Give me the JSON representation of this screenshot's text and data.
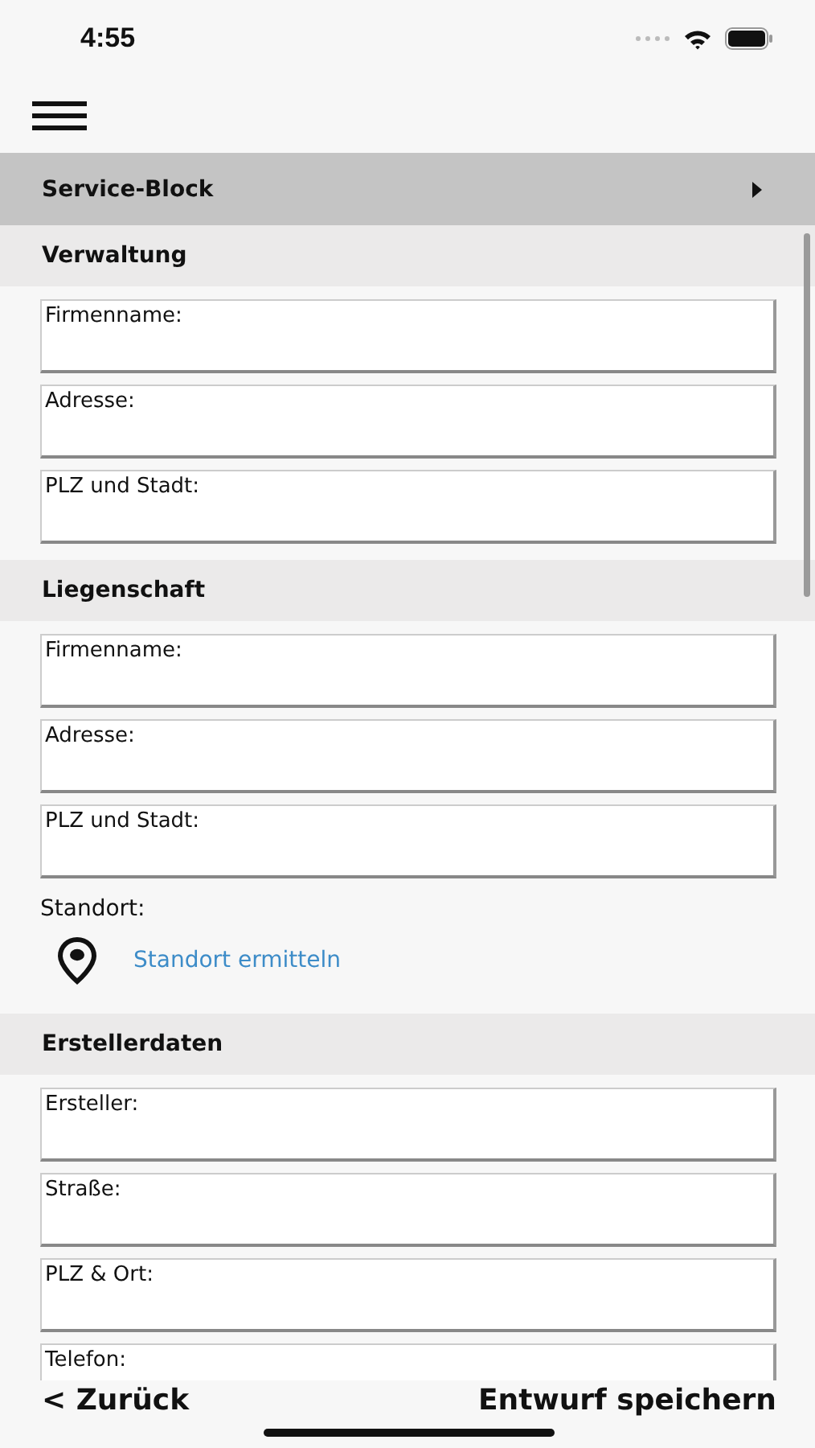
{
  "status_bar": {
    "time": "4:55"
  },
  "service_block": {
    "title": "Service-Block",
    "expanded": false
  },
  "sections": [
    {
      "title": "Verwaltung",
      "items": [
        {
          "kind": "field",
          "placeholder": "Firmenname:"
        },
        {
          "kind": "field",
          "placeholder": "Adresse:"
        },
        {
          "kind": "field",
          "placeholder": "PLZ und Stadt:"
        }
      ]
    },
    {
      "title": "Liegenschaft",
      "items": [
        {
          "kind": "field",
          "placeholder": "Firmenname:"
        },
        {
          "kind": "field",
          "placeholder": "Adresse:"
        },
        {
          "kind": "field",
          "placeholder": "PLZ und Stadt:"
        },
        {
          "kind": "label",
          "text": "Standort:"
        },
        {
          "kind": "action",
          "text": "Standort ermitteln"
        }
      ]
    },
    {
      "title": "Erstellerdaten",
      "items": [
        {
          "kind": "field",
          "placeholder": "Ersteller:"
        },
        {
          "kind": "field",
          "placeholder": "Straße:"
        },
        {
          "kind": "field",
          "placeholder": "PLZ & Ort:"
        },
        {
          "kind": "field",
          "placeholder": "Telefon:"
        }
      ]
    }
  ],
  "footer": {
    "back": "< Zurück",
    "save": "Entwurf speichern"
  }
}
